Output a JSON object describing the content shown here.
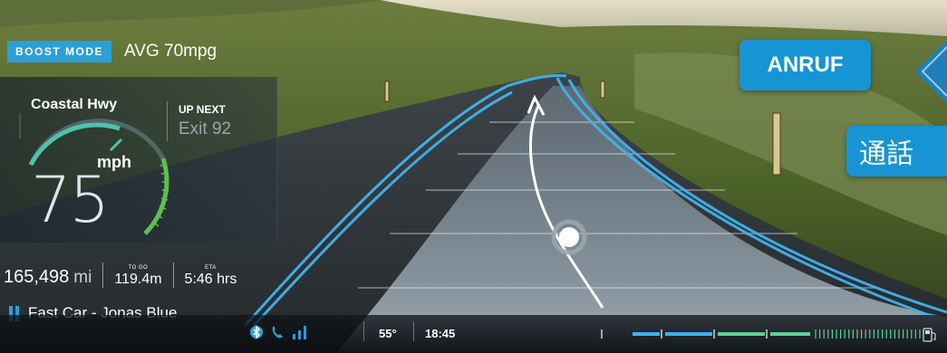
{
  "header": {
    "boost_mode_label": "BOOST MODE",
    "avg_mileage": "AVG 70mpg"
  },
  "speed_panel": {
    "road_name": "Coastal Hwy",
    "up_next_label": "UP NEXT",
    "up_next_value": "Exit 92",
    "speed_unit": "mph",
    "speed_value": "75",
    "gauge_level": 0.75
  },
  "trip": {
    "odometer": "165,498",
    "odometer_unit": "mi",
    "to_go_caption": "TO GO",
    "to_go_value": "119.4m",
    "eta_caption": "ETA",
    "eta_value": "5:46 hrs"
  },
  "media": {
    "track": "Fast Car - Jonas Blue",
    "state_icon": "pause-icon"
  },
  "status_bar": {
    "icons": [
      "bluetooth-icon",
      "phone-icon",
      "signal-bars-icon"
    ],
    "temperature": "55°",
    "clock": "18:45",
    "fuel_icon": "fuel-pump-icon"
  },
  "actions": {
    "call_de": "ANRUF",
    "call_jp": "通話"
  },
  "colors": {
    "accent_blue": "#2b9fd8",
    "button_blue": "#1794d4",
    "gauge_green": "#5fc04c",
    "gauge_teal": "#4fc3b0"
  }
}
